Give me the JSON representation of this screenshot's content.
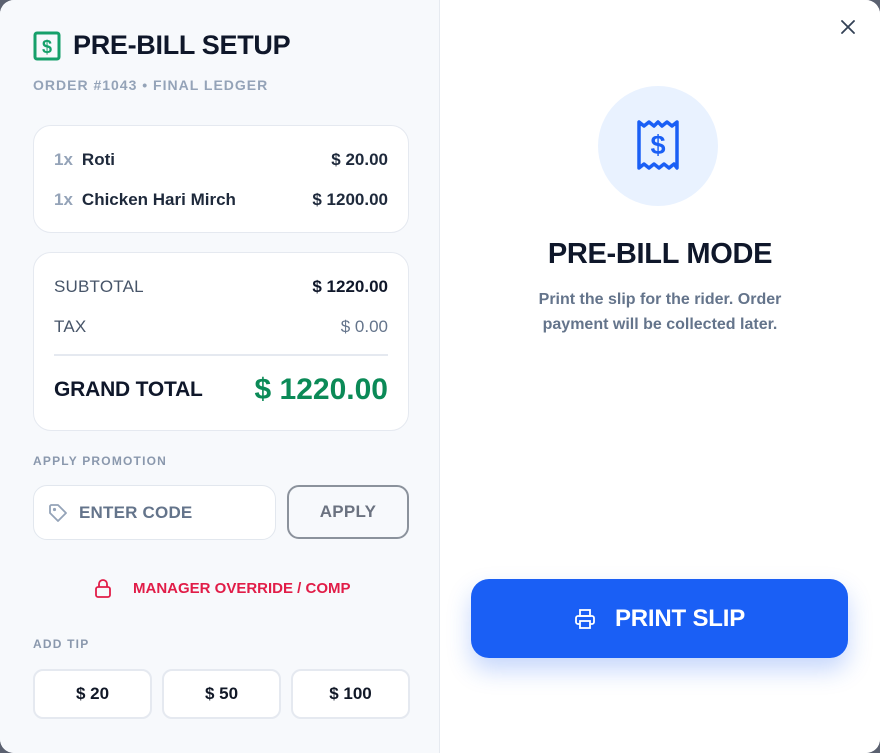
{
  "header": {
    "title": "PRE-BILL SETUP",
    "subtitle": "ORDER #1043 • FINAL LEDGER"
  },
  "items": [
    {
      "qty": "1x",
      "name": "Roti",
      "price": "$ 20.00"
    },
    {
      "qty": "1x",
      "name": "Chicken Hari Mirch",
      "price": "$ 1200.00"
    }
  ],
  "totals": {
    "subtotal_label": "SUBTOTAL",
    "subtotal_value": "$ 1220.00",
    "tax_label": "TAX",
    "tax_value": "$ 0.00",
    "grand_label": "GRAND TOTAL",
    "grand_value": "$ 1220.00"
  },
  "promotion": {
    "section_label": "APPLY PROMOTION",
    "placeholder": "ENTER CODE",
    "apply_label": "APPLY"
  },
  "override": {
    "label": "MANAGER OVERRIDE / COMP"
  },
  "tip": {
    "section_label": "ADD TIP",
    "options": [
      "$ 20",
      "$ 50",
      "$ 100"
    ]
  },
  "mode": {
    "title": "PRE-BILL MODE",
    "description": "Print the slip for the rider. Order payment will be collected later."
  },
  "print": {
    "label": "PRINT SLIP"
  },
  "colors": {
    "accent": "#1a5ff5",
    "brand_green": "#0b8a57",
    "alert_red": "#e11d48",
    "icon_green": "#16a06a"
  },
  "icons": {
    "title": "receipt-dollar-icon",
    "promo": "tag-icon",
    "override": "lock-icon",
    "mode": "receipt-dollar-icon",
    "print": "printer-icon",
    "close": "close-icon"
  }
}
